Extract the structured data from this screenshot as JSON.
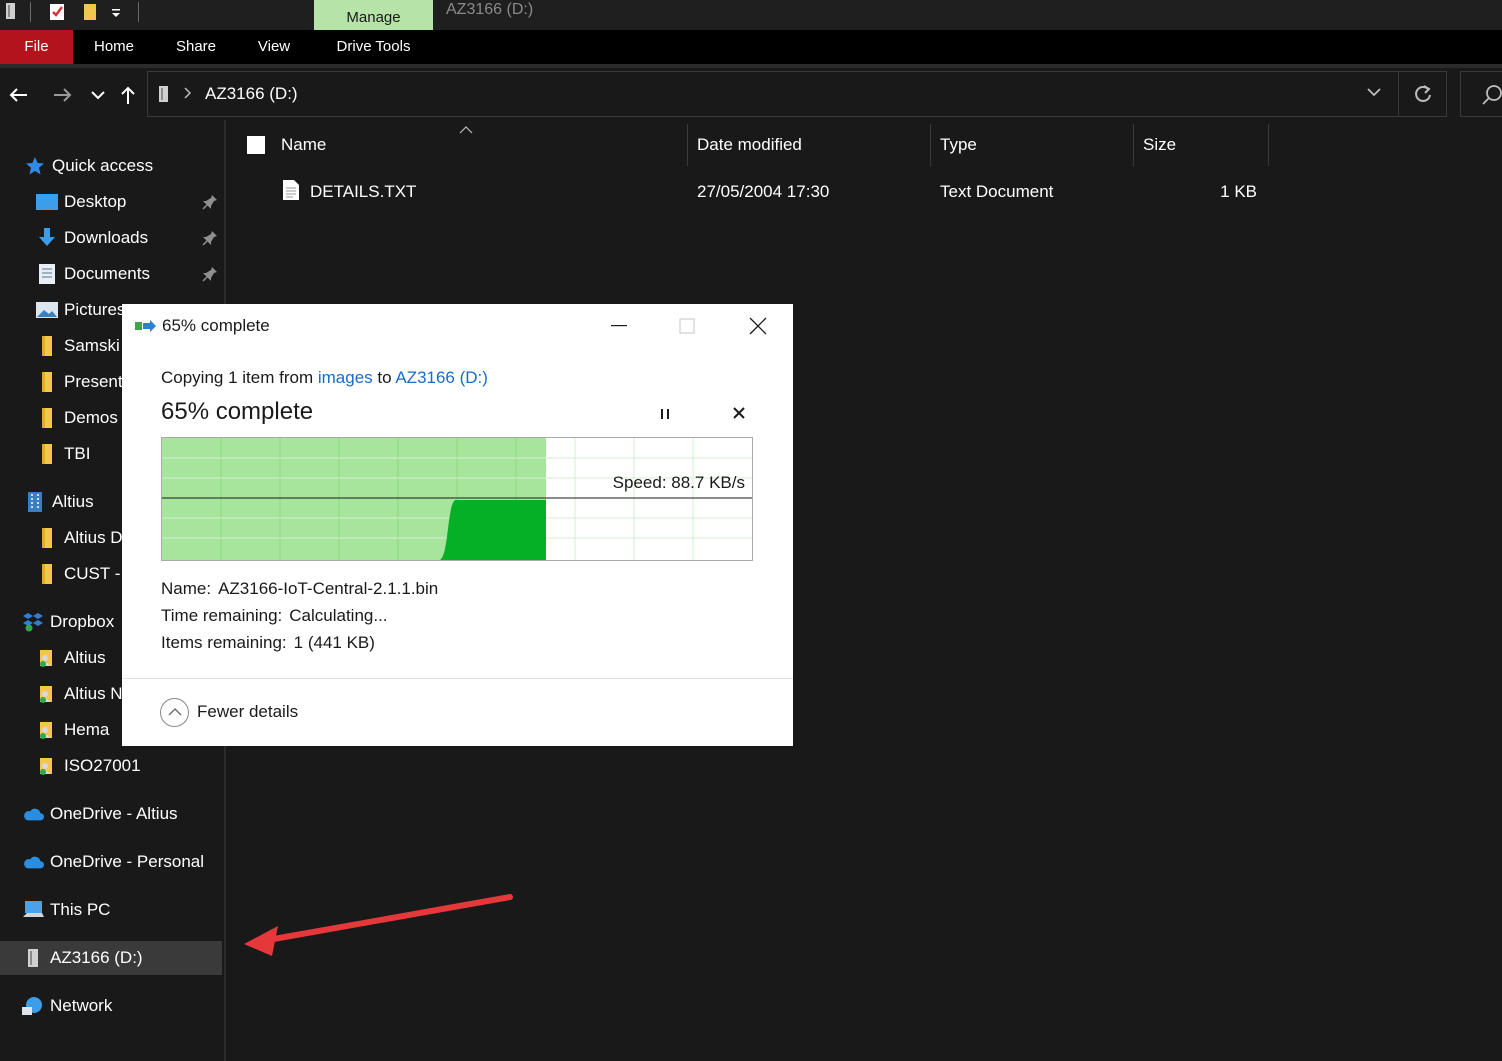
{
  "titlebar": {
    "manage_tab": "Manage",
    "window_title": "AZ3166 (D:)"
  },
  "ribbon": {
    "tabs": [
      "File",
      "Home",
      "Share",
      "View",
      "Drive Tools"
    ]
  },
  "address": {
    "path": "AZ3166 (D:)"
  },
  "sidebar": {
    "items": [
      {
        "label": "Quick access",
        "icon": "star-icon",
        "pinned": false
      },
      {
        "label": "Desktop",
        "icon": "desktop-icon",
        "pinned": true
      },
      {
        "label": "Downloads",
        "icon": "download-arrow-icon",
        "pinned": true
      },
      {
        "label": "Documents",
        "icon": "document-icon",
        "pinned": true
      },
      {
        "label": "Pictures",
        "icon": "pictures-icon",
        "pinned": false
      },
      {
        "label": "Samski",
        "icon": "folder-icon",
        "pinned": false
      },
      {
        "label": "Present",
        "icon": "folder-icon",
        "pinned": false
      },
      {
        "label": "Demos",
        "icon": "folder-icon",
        "pinned": false
      },
      {
        "label": "TBI",
        "icon": "folder-icon",
        "pinned": false
      },
      {
        "label": "Altius",
        "icon": "building-icon",
        "pinned": false
      },
      {
        "label": "Altius D",
        "icon": "folder-icon",
        "pinned": false
      },
      {
        "label": "CUST -",
        "icon": "folder-icon",
        "pinned": false
      },
      {
        "label": "Dropbox",
        "icon": "dropbox-icon",
        "pinned": false
      },
      {
        "label": "Altius",
        "icon": "shared-folder-icon",
        "pinned": false
      },
      {
        "label": "Altius N",
        "icon": "shared-folder-icon",
        "pinned": false
      },
      {
        "label": "Hema",
        "icon": "shared-folder-icon",
        "pinned": false
      },
      {
        "label": "ISO27001",
        "icon": "shared-folder-icon",
        "pinned": false
      },
      {
        "label": "OneDrive - Altius",
        "icon": "cloud-icon",
        "pinned": false
      },
      {
        "label": "OneDrive - Personal",
        "icon": "cloud-icon",
        "pinned": false
      },
      {
        "label": "This PC",
        "icon": "computer-icon",
        "pinned": false
      },
      {
        "label": "AZ3166 (D:)",
        "icon": "drive-icon",
        "pinned": false,
        "selected": true
      },
      {
        "label": "Network",
        "icon": "network-icon",
        "pinned": false
      }
    ]
  },
  "filelist": {
    "columns": [
      "Name",
      "Date modified",
      "Type",
      "Size"
    ],
    "rows": [
      {
        "name": "DETAILS.TXT",
        "date": "27/05/2004 17:30",
        "type": "Text Document",
        "size": "1 KB"
      }
    ]
  },
  "dialog": {
    "title": "65% complete",
    "copy_prefix": "Copying 1 item from ",
    "source": "images",
    "copy_mid": " to ",
    "destination": "AZ3166 (D:)",
    "progress_text": "65% complete",
    "progress_fraction": 0.65,
    "speed": "Speed: 88.7 KB/s",
    "name_label": "Name:",
    "name_value": "AZ3166-IoT-Central-2.1.1.bin",
    "time_label": "Time remaining:",
    "time_value": "Calculating...",
    "items_label": "Items remaining:",
    "items_value": "1 (441 KB)",
    "fewer_details": "Fewer details"
  },
  "colors": {
    "accent_file_tab": "#b3131d",
    "manage_tab": "#b6e3a8",
    "progress_light": "#a7e59c",
    "progress_dark": "#06b025",
    "link": "#1b6ac9",
    "annotation_arrow": "#e5383b"
  }
}
